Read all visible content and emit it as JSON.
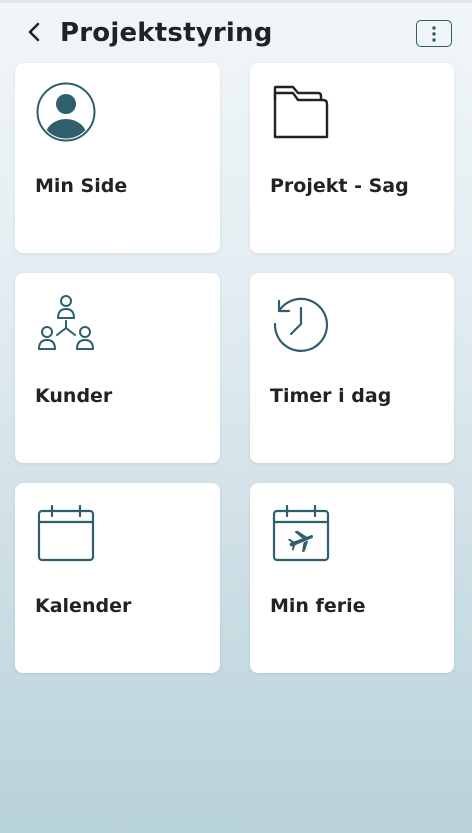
{
  "header": {
    "title": "Projektstyring",
    "back_icon": "chevron-left-icon",
    "menu_icon": "more-vertical-icon"
  },
  "colors": {
    "icon_teal": "#2f5f6c",
    "tile_background": "#ffffff",
    "title_text": "#1f2326"
  },
  "tiles": [
    {
      "label": "Min Side",
      "icon": "user-avatar-icon"
    },
    {
      "label": "Projekt - Sag",
      "icon": "folder-icon"
    },
    {
      "label": "Kunder",
      "icon": "customers-network-icon"
    },
    {
      "label": "Timer i dag",
      "icon": "clock-history-icon"
    },
    {
      "label": "Kalender",
      "icon": "calendar-icon"
    },
    {
      "label": "Min ferie",
      "icon": "calendar-vacation-icon"
    }
  ]
}
